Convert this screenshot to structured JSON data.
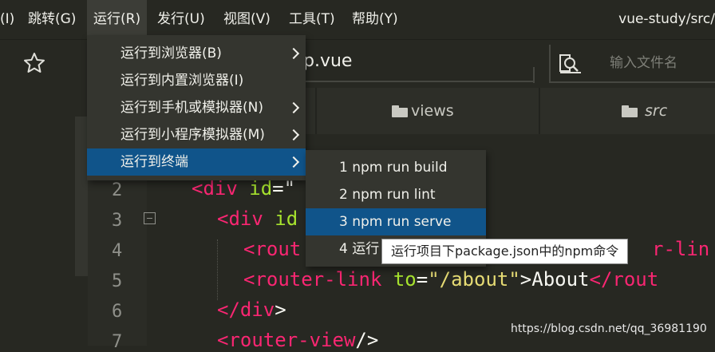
{
  "menubar": {
    "items": [
      {
        "label": "(I)"
      },
      {
        "label": "跳转(G)"
      },
      {
        "label": "运行(R)"
      },
      {
        "label": "发行(U)"
      },
      {
        "label": "视图(V)"
      },
      {
        "label": "工具(T)"
      },
      {
        "label": "帮助(Y)"
      }
    ],
    "window_title": "vue-study/src/"
  },
  "toolbar": {
    "star_icon": "star-icon",
    "active_file_tab": "p.vue",
    "search_icon": "search-file-icon",
    "file_search_placeholder": "输入文件名"
  },
  "breadcrumb": {
    "items": [
      {
        "label": "views",
        "icon": "folder-icon",
        "italic": false
      },
      {
        "label": "src",
        "icon": "folder-icon",
        "italic": true
      }
    ]
  },
  "editor": {
    "line_numbers": [
      "2",
      "3",
      "4",
      "5",
      "6",
      "7"
    ],
    "lines": [
      {
        "tag_open": "<div ",
        "attr": "id",
        "eq": "=\""
      },
      {
        "tag_open": "<div ",
        "attr": "id"
      },
      {
        "tag_open": "<rout",
        "tail": "r-lin"
      },
      {
        "tag_open": "<router-link ",
        "attr": "to",
        "eq": "=",
        "str": "\"/about\"",
        "gt": ">",
        "text": "About",
        "tag_close": "</rout"
      },
      {
        "tag_open": "</div",
        "gt": ">"
      },
      {
        "tag_open": "<router-view",
        "gt": "/>"
      }
    ]
  },
  "run_menu": {
    "items": [
      {
        "label": "运行到浏览器(B)",
        "has_submenu": true
      },
      {
        "label": "运行到内置浏览器(I)",
        "has_submenu": false
      },
      {
        "label": "运行到手机或模拟器(N)",
        "has_submenu": true
      },
      {
        "label": "运行到小程序模拟器(M)",
        "has_submenu": true
      },
      {
        "label": "运行到终端",
        "has_submenu": true,
        "selected": true
      }
    ]
  },
  "terminal_menu": {
    "items": [
      {
        "label": "1 npm run build"
      },
      {
        "label": "2 npm run lint"
      },
      {
        "label": "3 npm run serve",
        "selected": true
      },
      {
        "label": "4 运行"
      }
    ]
  },
  "tooltip": {
    "text": "运行项目下package.json中的npm命令"
  },
  "watermark": {
    "text": "https://blog.csdn.net/qq_36981190"
  },
  "colors": {
    "background": "#272822",
    "menu_background": "#34352f",
    "selection": "#10548a",
    "tag": "#f92672",
    "attribute": "#a6e22e",
    "string": "#e6db74"
  }
}
